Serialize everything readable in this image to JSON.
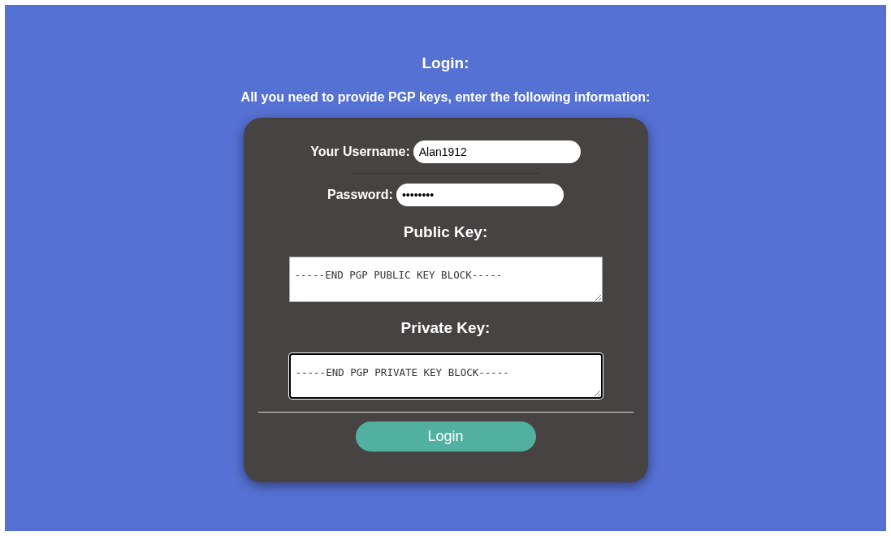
{
  "title": "Login:",
  "subtitle": "All you need to provide PGP keys, enter the following information:",
  "form": {
    "username": {
      "label": "Your Username:",
      "value": "Alan1912"
    },
    "password": {
      "label": "Password:",
      "value": "••••••••"
    },
    "public_key": {
      "label": "Public Key:",
      "value": "-----END PGP PUBLIC KEY BLOCK-----",
      "focused": false
    },
    "private_key": {
      "label": "Private Key:",
      "value": "-----END PGP PRIVATE KEY BLOCK-----",
      "focused": true
    },
    "submit": "Login"
  }
}
